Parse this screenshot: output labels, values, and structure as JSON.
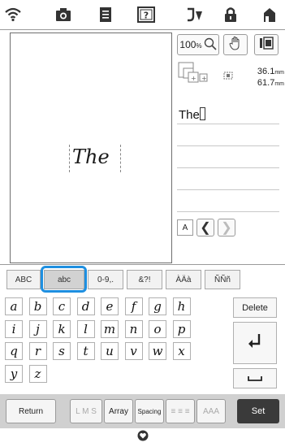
{
  "status_icons": [
    "wifi-icon",
    "camera-icon",
    "document-icon",
    "help-icon",
    "thread-icon",
    "lock-icon",
    "home-icon"
  ],
  "canvas": {
    "preview_text": "The"
  },
  "zoom": {
    "percent": "100",
    "percent_unit": "%"
  },
  "size": {
    "width": "36.1",
    "height": "61.7",
    "unit": "mm"
  },
  "lines": [
    "The",
    "",
    "",
    "",
    ""
  ],
  "nav": {
    "font_label": "A"
  },
  "tabs": [
    "ABC",
    "abc",
    "0-9,.",
    "&?!",
    "ÀÄà",
    "ÑÑñ"
  ],
  "active_tab": "abc",
  "keys": [
    [
      "a",
      "b",
      "c",
      "d",
      "e",
      "f",
      "g",
      "h"
    ],
    [
      "i",
      "j",
      "k",
      "l",
      "m",
      "n",
      "o",
      "p"
    ],
    [
      "q",
      "r",
      "s",
      "t",
      "u",
      "v",
      "w",
      "x"
    ],
    [
      "y",
      "z"
    ]
  ],
  "keyboard": {
    "delete_label": "Delete"
  },
  "bottom": {
    "return_label": "Return",
    "size_label": "L M S",
    "array_label": "Array",
    "spacing_label": "Spacing",
    "align_label": "≡ ≡ ≡",
    "case_label": "AAA",
    "set_label": "Set"
  },
  "colors": {
    "highlight": "#1e8fe0",
    "set_button": "#3a3a3a",
    "bottom_bar": "#d0d0d0"
  }
}
